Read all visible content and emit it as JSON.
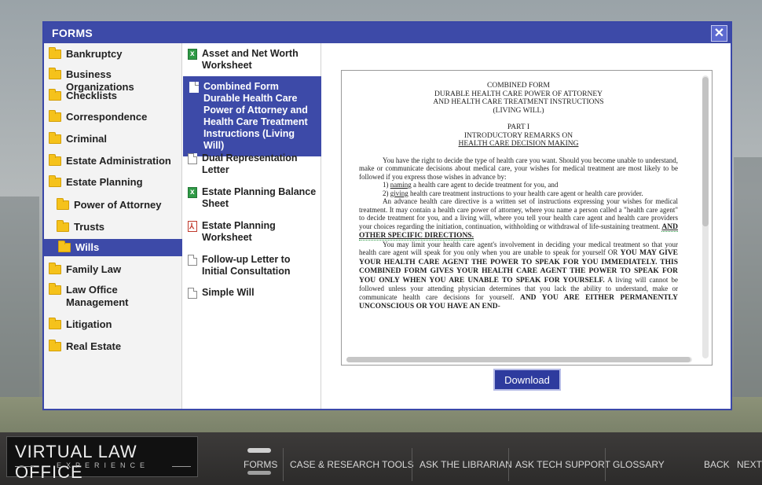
{
  "modal": {
    "title": "FORMS",
    "close_label": "✕"
  },
  "categories": [
    {
      "label": "Bankruptcy"
    },
    {
      "label": "Business Organizations"
    },
    {
      "label": "Checklists"
    },
    {
      "label": "Correspondence"
    },
    {
      "label": "Criminal"
    },
    {
      "label": "Estate Administration"
    },
    {
      "label": "Estate Planning"
    },
    {
      "label": "Power of Attorney"
    },
    {
      "label": "Trusts"
    },
    {
      "label": "Wills"
    },
    {
      "label": "Family Law"
    },
    {
      "label": "Law Office Management"
    },
    {
      "label": "Litigation"
    },
    {
      "label": "Real Estate"
    }
  ],
  "files": [
    {
      "label": "Asset and Net Worth Worksheet",
      "icon": "excel-icon"
    },
    {
      "label": "Combined Form Durable Health Care Power of Attorney and Health Care Treatment Instructions (Living Will)",
      "icon": "document-icon"
    },
    {
      "label": "Dual Representation Letter",
      "icon": "document-icon"
    },
    {
      "label": "Estate Planning Balance Sheet",
      "icon": "excel-icon"
    },
    {
      "label": "Estate Planning Worksheet",
      "icon": "pdf-icon"
    },
    {
      "label": "Follow-up Letter to Initial Consultation",
      "icon": "document-icon"
    },
    {
      "label": "Simple Will",
      "icon": "document-icon"
    }
  ],
  "document": {
    "head": [
      "COMBINED FORM",
      "DURABLE HEALTH CARE POWER OF ATTORNEY",
      "AND HEALTH CARE TREATMENT INSTRUCTIONS",
      "(LIVING WILL)"
    ],
    "part": "PART I",
    "part_title": "INTRODUCTORY REMARKS ON",
    "part_subtitle": "HEALTH CARE DECISION MAKING",
    "p1": "You have the right to decide the type of health care you want.  Should you become unable to understand, make or communicate decisions about medical care, your wishes for medical treatment are most likely to be followed if you express those wishes in advance by:",
    "item1_pre": "1) ",
    "item1_u": "naming",
    "item1_post": " a health care agent to decide treatment for you, and",
    "item2_pre": "2) ",
    "item2_u": "giving",
    "item2_post": " health care treatment instructions to your health care agent or health care provider.",
    "p2": "An advance health care directive is a written set of instructions expressing your wishes for medical treatment. It may contain a health care power of attorney, where you name a person called a \"health care agent\" to decide treatment for you, and a living will, where you tell your health care agent and health care providers your choices regarding the initiation, continuation, withholding or withdrawal of life-sustaining treatment.",
    "p2_caps": "AND OTHER SPECIFIC DIRECTIONS.",
    "p3": "You may limit your health care agent's involvement in deciding your medical treatment so that your health care agent will speak for you only when you are unable to speak for yourself OR",
    "p3_caps": "YOU MAY GIVE YOUR HEALTH CARE AGENT THE POWER TO SPEAK FOR YOU IMMEDIATELY. THIS COMBINED FORM GIVES YOUR HEALTH CARE AGENT THE POWER TO SPEAK FOR YOU ONLY WHEN YOU ARE UNABLE TO SPEAK FOR YOURSELF.",
    "p3_rest": "A living will cannot be followed unless your attending physician determines that you lack the ability to understand, make or communicate health care decisions for yourself.",
    "p3_caps2": "AND YOU ARE EITHER PERMANENTLY UNCONSCIOUS OR YOU HAVE AN END-"
  },
  "download_label": "Download",
  "logo": {
    "title": "VIRTUAL LAW OFFICE",
    "subtitle": "EXPERIENCE"
  },
  "nav": [
    "FORMS",
    "CASE & RESEARCH TOOLS",
    "ASK THE LIBRARIAN",
    "ASK TECH SUPPORT",
    "GLOSSARY",
    "BACK",
    "NEXT"
  ]
}
